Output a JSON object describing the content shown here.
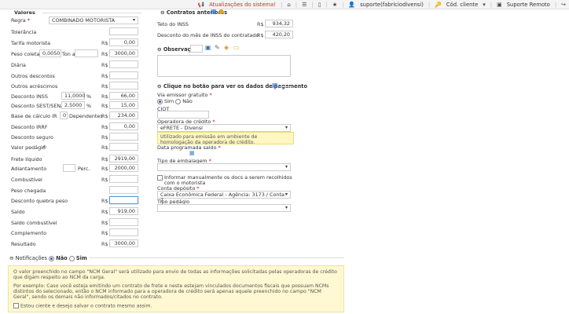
{
  "topbar": {
    "updates": "Atualizações do sistema!",
    "user": "suporte(fabriciodivensi)",
    "client_code": "Cód. cliente",
    "remote": "Suporte Remoto"
  },
  "left": {
    "header": "Valores",
    "regra_label": "Regra",
    "regra_value": "COMBINADO MOTORISTA",
    "tolerancia": "Tolerância",
    "tarifa_label": "Tarifa motorista",
    "tarifa_value": "0,00",
    "peso_coleta_label": "Peso coleta",
    "peso_coleta_value": "0,0050",
    "ton_a": "Ton a",
    "peso_coleta_rs": "3000,00",
    "diaria": "Diária",
    "outros_desc": "Outros descontos",
    "outros_acr": "Outros acréscimos",
    "desc_inss_label": "Desconto INSS",
    "desc_inss_pct": "11,0000",
    "desc_inss_value": "66,00",
    "desc_sest_label": "Desconto SEST/SENAT",
    "desc_sest_pct": "2,5000",
    "desc_sest_value": "15,00",
    "base_ir_label": "Base de cálculo IR",
    "dependentes_value": "0",
    "dependentes_label": "Dependentes",
    "base_ir_value": "234,00",
    "desc_irrf_label": "Desconto IRRF",
    "desc_irrf_value": "0,00",
    "desc_seguro": "Desconto seguro",
    "valor_pedagio": "Valor pedágio",
    "frete_liquido_label": "Frete líquido",
    "frete_liquido_value": "2919,00",
    "adiantamento_label": "Adiantamento",
    "perc": "Perc.",
    "adiantamento_value": "2000,00",
    "combustivel": "Combustível",
    "peso_chegada": "Peso chegada",
    "desc_quebra": "Desconto quebra peso",
    "saldo_label": "Saldo",
    "saldo_value": "919,00",
    "saldo_comb": "Saldo combustível",
    "complemento": "Complemento",
    "resultado_label": "Resultado",
    "resultado_value": "3000,00",
    "currency": "R$",
    "pct": "%"
  },
  "right": {
    "contratos_header": "Contratos anteriores",
    "teto_label": "Teto do INSS",
    "teto_value": "934,32",
    "desc_mes_label": "Desconto do mês de INSS do contratado",
    "desc_mes_value": "420,20",
    "obs_label": "Observações",
    "pagamento_header": "Clique no botão para ver os dados de pagamento",
    "via_emissor_label": "Via emissor gratuito",
    "sim": "Sim",
    "nao": "Não",
    "ciot_label": "CIOT",
    "operadora_label": "Operadora de crédito",
    "operadora_value": "eFRETE - Divensi",
    "operadora_warn": "Utilizado para emissão em ambiente de homologação da operadora de crédito.",
    "data_prog_label": "Data programada saldo",
    "tipo_emb_label": "Tipo de embalagem",
    "informar_label": "Informar manualmente os docs a serem recolhidos com o motorista",
    "conta_label": "Conta depósito",
    "conta_value": "Caixa Econômica Federal - Agência: 3173 / Conta: 7",
    "tipo_pedagio_label": "Tipo pedágio"
  },
  "notifications": {
    "label": "Notificações",
    "nao": "Não",
    "sim": "Sim",
    "p1": "O valor preenchido no campo \"NCM Geral\" será utilizado para envio de todas as informações solicitadas pelas operadoras de crédito que digam respeito ao NCM da carga.",
    "p2": "Por exemplo: Caso você esteja emitindo um contrato de frete e neste estejam vinculados documentos fiscais que possuam NCMs distintos do selecionado, então o NCM informado para a operadora de crédito será apenas aquele preenchido no campo \"NCM Geral\", sendo os demais não informados/citados no contrato.",
    "confirm": "Estou ciente e desejo salvar o contrato mesmo assim."
  }
}
